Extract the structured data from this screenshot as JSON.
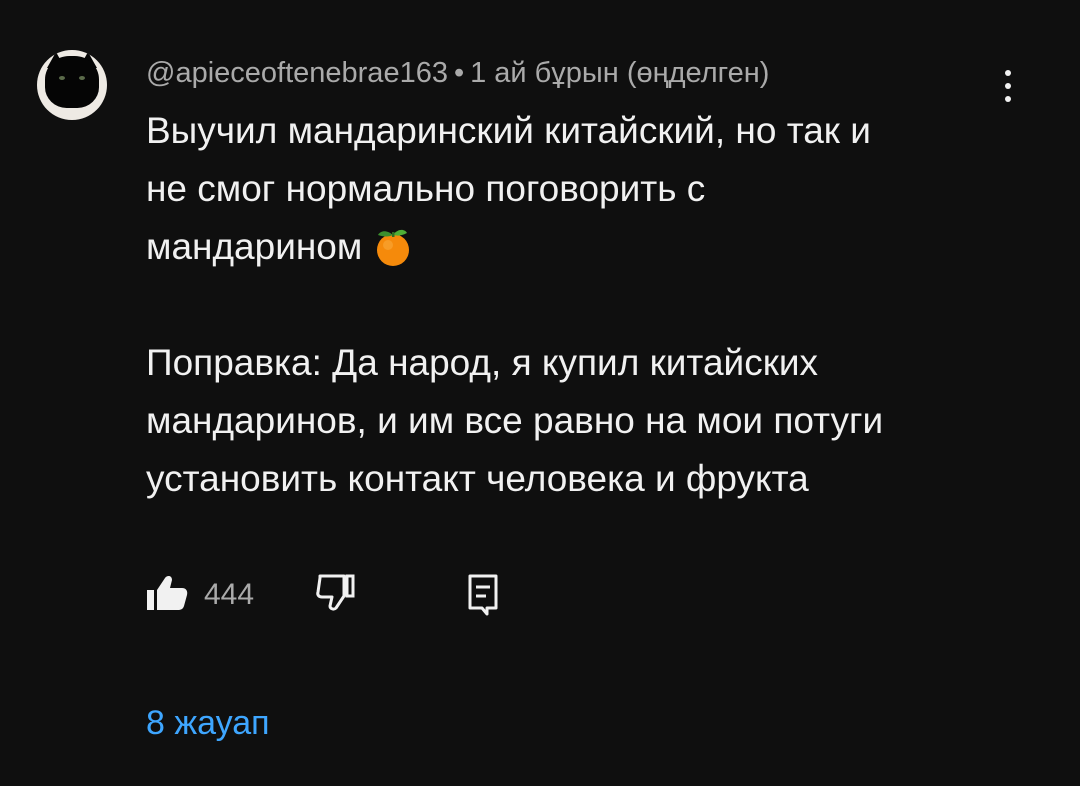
{
  "comment": {
    "author": "@apieceoftenebrae163",
    "separator": "•",
    "time": "1 ай бұрын (өңделген)",
    "text_lines": [
      "Выучил мандаринский китайский, но так и",
      "не смог нормально поговорить с",
      "мандарином"
    ],
    "edit_lines": [
      "Поправка: Да народ, я купил китайских",
      "мандаринов, и им все равно на мои потуги",
      "установить контакт человека и фрукта"
    ],
    "emoji": "tangerine-emoji",
    "like_count": "444",
    "replies_label": "8 жауап"
  },
  "colors": {
    "background": "#0f0f0f",
    "text": "#f1f1f1",
    "meta": "#aaaaaa",
    "link": "#3ea6ff"
  },
  "icons": {
    "menu": "more-vert-icon",
    "like": "thumb-up-icon",
    "dislike": "thumb-down-icon",
    "reply": "comment-reply-icon"
  }
}
